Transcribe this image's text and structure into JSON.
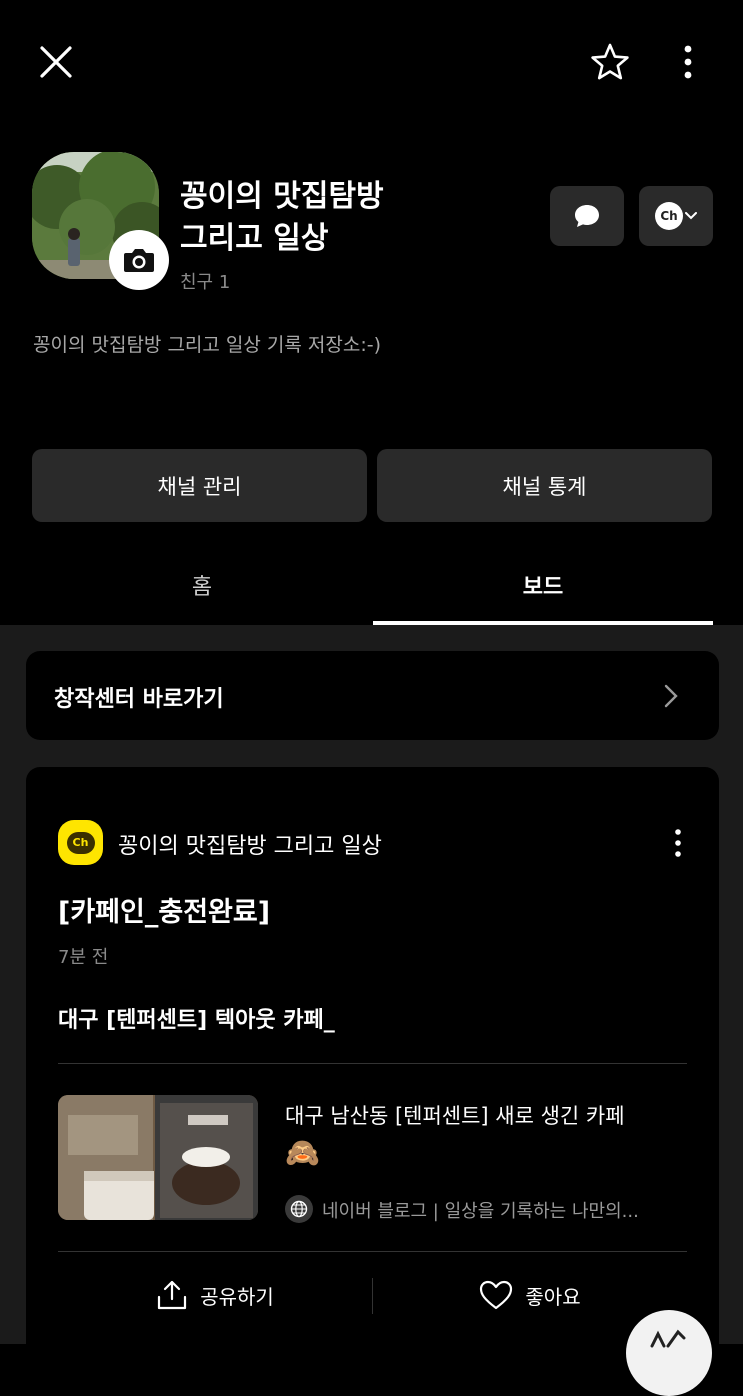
{
  "header": {
    "close_icon": "close-icon",
    "star_icon": "star-icon",
    "more_icon": "more-vertical-icon"
  },
  "profile": {
    "name_line1": "꽁이의 맛집탐방",
    "name_line2": "그리고 일상",
    "friends": "친구 1",
    "description": "꽁이의 맛집탐방 그리고 일상 기록 저장소:-)",
    "chat_icon": "chat-bubble-icon",
    "channel_icon_label": "Ch"
  },
  "actions": {
    "manage": "채널 관리",
    "stats": "채널 통계"
  },
  "tabs": {
    "home": "홈",
    "board": "보드",
    "active": "board"
  },
  "creator_center": {
    "label": "창작센터 바로가기"
  },
  "post": {
    "channel_badge": "Ch",
    "channel_name": "꽁이의 맛집탐방 그리고 일상",
    "title": "[카페인_충전완료]",
    "time": "7분 전",
    "body": "대구 [텐퍼센트] 텍아웃 카페_",
    "link": {
      "title": "대구 남산동 [텐퍼센트] 새로 생긴 카페",
      "emoji": "🙈",
      "source": "네이버 블로그 | 일상을 기록하는 나만의..."
    },
    "share": "공유하기",
    "like": "좋아요"
  },
  "colors": {
    "background": "#000000",
    "card": "#000000",
    "section_bg": "#1b1b1b",
    "button_bg": "#2a2a2a",
    "channel_yellow": "#fee500",
    "muted_text": "#8a8a8a"
  }
}
